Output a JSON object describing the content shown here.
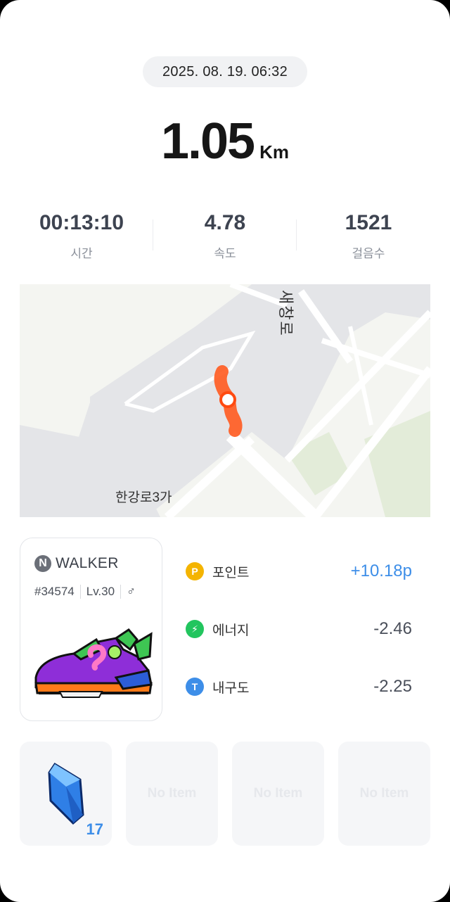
{
  "header": {
    "datetime": "2025. 08. 19. 06:32",
    "distance_value": "1.05",
    "distance_unit": "Km"
  },
  "stats": [
    {
      "value": "00:13:10",
      "label": "시간"
    },
    {
      "value": "4.78",
      "label": "속도"
    },
    {
      "value": "1521",
      "label": "걸음수"
    }
  ],
  "map": {
    "area_label": "한강로3가",
    "road_label": "새창로"
  },
  "shoe": {
    "brand_icon": "N",
    "brand": "WALKER",
    "id": "#34574",
    "level": "Lv.30",
    "gender_symbol": "♂"
  },
  "rewards": [
    {
      "icon": "point-icon",
      "icon_text": "P",
      "color": "#f4b400",
      "label": "포인트",
      "amount": "+10.18p"
    },
    {
      "icon": "energy-icon",
      "icon_text": "⚡",
      "color": "#22c55e",
      "label": "에너지",
      "amount": "-2.46"
    },
    {
      "icon": "durability-icon",
      "icon_text": "T",
      "color": "#3d8ee8",
      "label": "내구도",
      "amount": "-2.25"
    }
  ],
  "items": [
    {
      "type": "crystal",
      "count": "17"
    },
    {
      "empty_label": "No Item"
    },
    {
      "empty_label": "No Item"
    },
    {
      "empty_label": "No Item"
    }
  ]
}
